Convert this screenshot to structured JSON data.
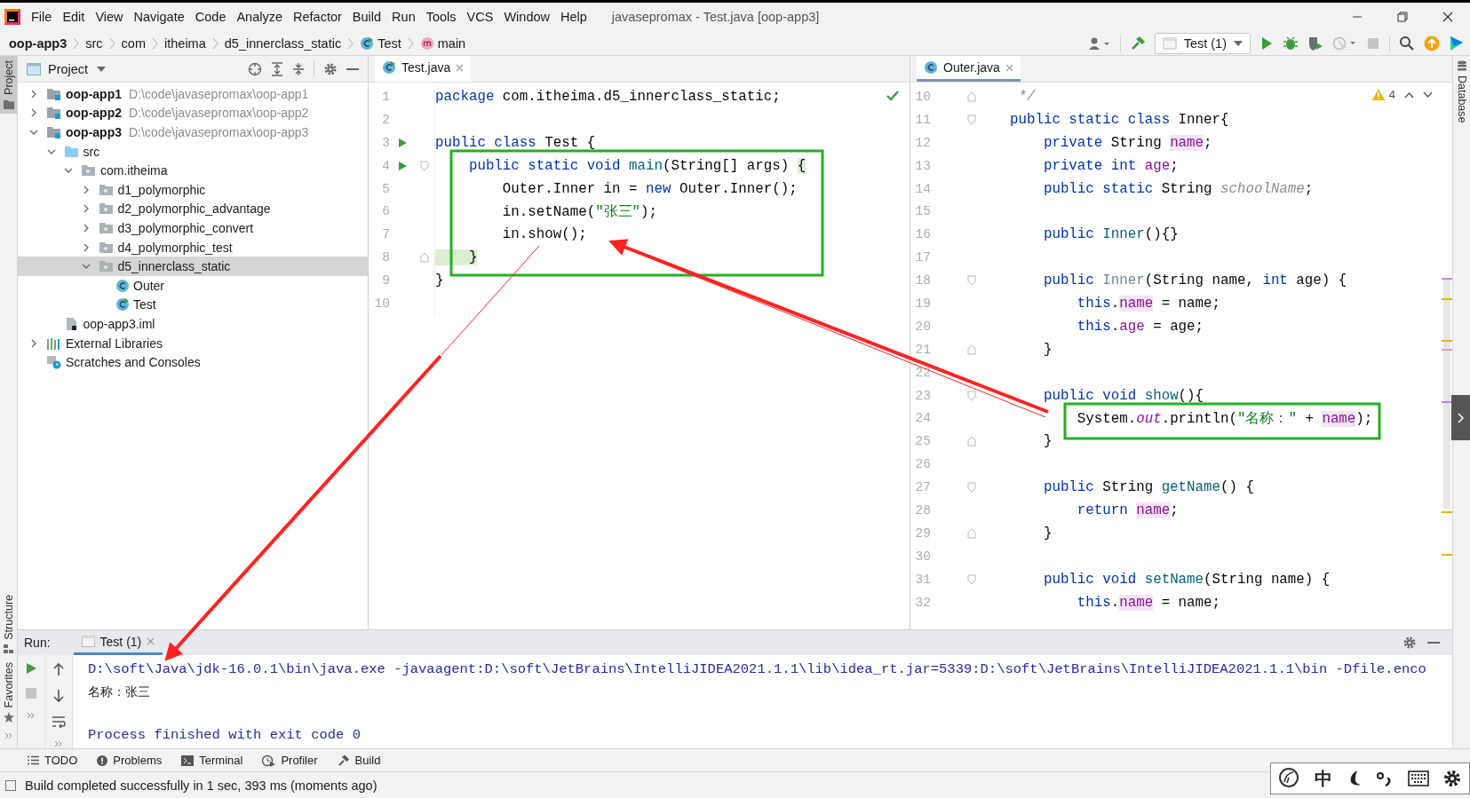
{
  "menu_bar": {
    "menus": [
      "File",
      "Edit",
      "View",
      "Navigate",
      "Code",
      "Analyze",
      "Refactor",
      "Build",
      "Run",
      "Tools",
      "VCS",
      "Window",
      "Help"
    ],
    "title": "javasepromax - Test.java [oop-app3]"
  },
  "breadcrumbs": [
    {
      "label": "oop-app3",
      "kind": "module"
    },
    {
      "label": "src",
      "kind": "folder"
    },
    {
      "label": "com",
      "kind": "folder"
    },
    {
      "label": "itheima",
      "kind": "folder"
    },
    {
      "label": "d5_innerclass_static",
      "kind": "folder"
    },
    {
      "label": "Test",
      "kind": "class"
    },
    {
      "label": "main",
      "kind": "method"
    }
  ],
  "toolbar": {
    "run_config": "Test (1)"
  },
  "left_stripe": [
    {
      "label": "Project",
      "selected": true
    },
    {
      "label": "Structure",
      "selected": false
    },
    {
      "label": "Favorites",
      "selected": false
    }
  ],
  "right_stripe": [
    {
      "label": "Database"
    }
  ],
  "project_panel": {
    "title": "Project",
    "tree": [
      {
        "label": "oop-app1",
        "path": "D:\\code\\javasepromax\\oop-app1",
        "kind": "module",
        "expanded": false,
        "selected": false
      },
      {
        "label": "oop-app2",
        "path": "D:\\code\\javasepromax\\oop-app2",
        "kind": "module",
        "expanded": false,
        "selected": false
      },
      {
        "label": "oop-app3",
        "path": "D:\\code\\javasepromax\\oop-app3",
        "kind": "module",
        "expanded": true,
        "selected": false,
        "children": [
          {
            "label": "src",
            "kind": "source",
            "expanded": true,
            "selected": false,
            "children": [
              {
                "label": "com.itheima",
                "kind": "package",
                "expanded": true,
                "selected": false,
                "children": [
                  {
                    "label": "d1_polymorphic",
                    "kind": "package",
                    "expanded": false,
                    "selected": false
                  },
                  {
                    "label": "d2_polymorphic_advantage",
                    "kind": "package",
                    "expanded": false,
                    "selected": false
                  },
                  {
                    "label": "d3_polymorphic_convert",
                    "kind": "package",
                    "expanded": false,
                    "selected": false
                  },
                  {
                    "label": "d4_polymorphic_test",
                    "kind": "package",
                    "expanded": false,
                    "selected": false
                  },
                  {
                    "label": "d5_innerclass_static",
                    "kind": "package",
                    "expanded": true,
                    "selected": true,
                    "children": [
                      {
                        "label": "Outer",
                        "kind": "class",
                        "selected": false
                      },
                      {
                        "label": "Test",
                        "kind": "main-class",
                        "selected": false
                      }
                    ]
                  }
                ]
              }
            ]
          },
          {
            "label": "oop-app3.iml",
            "kind": "iml",
            "selected": false
          }
        ]
      },
      {
        "label": "External Libraries",
        "kind": "libraries",
        "expanded": false,
        "selected": false
      },
      {
        "label": "Scratches and Consoles",
        "kind": "scratches",
        "selected": false
      }
    ]
  },
  "editors": [
    {
      "tab": {
        "label": "Test.java",
        "selected": false
      },
      "indicator": {
        "kind": "ok"
      },
      "lines": [
        {
          "number": "1",
          "tokens": [
            {
              "kind": "kw",
              "text": "package"
            },
            {
              "kind": "plain",
              "text": " com.itheima.d5_innerclass_static;"
            }
          ]
        },
        {
          "number": "2"
        },
        {
          "number": "3",
          "gutter": {
            "kind": "run"
          },
          "tokens": [
            {
              "kind": "kw",
              "text": "public class"
            },
            {
              "kind": "plain",
              "text": " Test {"
            }
          ]
        },
        {
          "number": "4",
          "gutter": {
            "kind": "run-fold"
          },
          "tokens": [
            {
              "kind": "kw",
              "text": "    public static void "
            },
            {
              "kind": "method",
              "text": "main"
            },
            {
              "kind": "plain",
              "text": "(String[] args) "
            },
            {
              "kind": "brace",
              "text": "{"
            }
          ]
        },
        {
          "number": "5",
          "tokens": [
            {
              "kind": "plain",
              "text": "        Outer.Inner in = "
            },
            {
              "kind": "kw",
              "text": "new"
            },
            {
              "kind": "plain",
              "text": " Outer.Inner();"
            }
          ]
        },
        {
          "number": "6",
          "tokens": [
            {
              "kind": "plain",
              "text": "        in.setName("
            },
            {
              "kind": "str",
              "text": "\"张三\""
            },
            {
              "kind": "plain",
              "text": ");"
            }
          ]
        },
        {
          "number": "7",
          "tokens": [
            {
              "kind": "plain",
              "text": "        in.show();"
            }
          ]
        },
        {
          "number": "8",
          "gutter": {
            "kind": "fold-end"
          },
          "tokens": [
            {
              "kind": "brace",
              "text": "    }"
            }
          ]
        },
        {
          "number": "9",
          "tokens": [
            {
              "kind": "plain",
              "text": "}"
            }
          ]
        },
        {
          "number": "10"
        }
      ]
    },
    {
      "tab": {
        "label": "Outer.java",
        "selected": true
      },
      "indicator": {
        "kind": "warnings",
        "count": "4"
      },
      "lines": [
        {
          "number": "10",
          "gutter": {
            "kind": "fold-end"
          },
          "tokens": [
            {
              "kind": "comment",
              "text": " */"
            }
          ]
        },
        {
          "number": "11",
          "gutter": {
            "kind": "fold"
          },
          "tokens": [
            {
              "kind": "kw",
              "text": "public static class"
            },
            {
              "kind": "plain",
              "text": " Inner{"
            }
          ]
        },
        {
          "number": "12",
          "tokens": [
            {
              "kind": "kw",
              "text": "    private"
            },
            {
              "kind": "plain",
              "text": " String "
            },
            {
              "kind": "field-hl",
              "text": "name"
            },
            {
              "kind": "plain",
              "text": ";"
            }
          ]
        },
        {
          "number": "13",
          "tokens": [
            {
              "kind": "kw",
              "text": "    private int "
            },
            {
              "kind": "field",
              "text": "age"
            },
            {
              "kind": "plain",
              "text": ";"
            }
          ]
        },
        {
          "number": "14",
          "tokens": [
            {
              "kind": "kw",
              "text": "    public static"
            },
            {
              "kind": "plain",
              "text": " String "
            },
            {
              "kind": "unused-static",
              "text": "schoolName"
            },
            {
              "kind": "plain",
              "text": ";"
            }
          ]
        },
        {
          "number": "15"
        },
        {
          "number": "16",
          "tokens": [
            {
              "kind": "kw",
              "text": "    public "
            },
            {
              "kind": "method",
              "text": "Inner"
            },
            {
              "kind": "plain",
              "text": "(){}"
            }
          ]
        },
        {
          "number": "17"
        },
        {
          "number": "18",
          "gutter": {
            "kind": "fold"
          },
          "tokens": [
            {
              "kind": "kw",
              "text": "    public "
            },
            {
              "kind": "unused",
              "text": "Inner"
            },
            {
              "kind": "plain",
              "text": "(String name, "
            },
            {
              "kind": "kw",
              "text": "int"
            },
            {
              "kind": "plain",
              "text": " age) {"
            }
          ]
        },
        {
          "number": "19",
          "tokens": [
            {
              "kind": "kw",
              "text": "        this"
            },
            {
              "kind": "plain",
              "text": "."
            },
            {
              "kind": "field-hl",
              "text": "name"
            },
            {
              "kind": "plain",
              "text": " = name;"
            }
          ]
        },
        {
          "number": "20",
          "tokens": [
            {
              "kind": "kw",
              "text": "        this"
            },
            {
              "kind": "plain",
              "text": "."
            },
            {
              "kind": "field",
              "text": "age"
            },
            {
              "kind": "plain",
              "text": " = age;"
            }
          ]
        },
        {
          "number": "21",
          "gutter": {
            "kind": "fold-end"
          },
          "tokens": [
            {
              "kind": "plain",
              "text": "    }"
            }
          ]
        },
        {
          "number": "22"
        },
        {
          "number": "23",
          "gutter": {
            "kind": "fold"
          },
          "tokens": [
            {
              "kind": "kw",
              "text": "    public void "
            },
            {
              "kind": "method",
              "text": "show"
            },
            {
              "kind": "plain",
              "text": "(){"
            }
          ]
        },
        {
          "number": "24",
          "tokens": [
            {
              "kind": "plain",
              "text": "        System."
            },
            {
              "kind": "static",
              "text": "out"
            },
            {
              "kind": "plain",
              "text": ".println("
            },
            {
              "kind": "str",
              "text": "\"名称：\""
            },
            {
              "kind": "plain",
              "text": " + "
            },
            {
              "kind": "field-hl",
              "text": "name"
            },
            {
              "kind": "plain",
              "text": ");"
            }
          ]
        },
        {
          "number": "25",
          "gutter": {
            "kind": "fold-end"
          },
          "tokens": [
            {
              "kind": "plain",
              "text": "    }"
            }
          ]
        },
        {
          "number": "26"
        },
        {
          "number": "27",
          "gutter": {
            "kind": "fold"
          },
          "tokens": [
            {
              "kind": "kw",
              "text": "    public"
            },
            {
              "kind": "plain",
              "text": " String "
            },
            {
              "kind": "method",
              "text": "getName"
            },
            {
              "kind": "plain",
              "text": "() {"
            }
          ]
        },
        {
          "number": "28",
          "tokens": [
            {
              "kind": "kw",
              "text": "        return "
            },
            {
              "kind": "field-hl",
              "text": "name"
            },
            {
              "kind": "plain",
              "text": ";"
            }
          ]
        },
        {
          "number": "29",
          "gutter": {
            "kind": "fold-end"
          },
          "tokens": [
            {
              "kind": "plain",
              "text": "    }"
            }
          ]
        },
        {
          "number": "30"
        },
        {
          "number": "31",
          "gutter": {
            "kind": "fold"
          },
          "tokens": [
            {
              "kind": "kw",
              "text": "    public void "
            },
            {
              "kind": "method",
              "text": "setName"
            },
            {
              "kind": "plain",
              "text": "(String name) {"
            }
          ]
        },
        {
          "number": "32",
          "tokens": [
            {
              "kind": "kw",
              "text": "        this"
            },
            {
              "kind": "plain",
              "text": "."
            },
            {
              "kind": "field-hl",
              "text": "name"
            },
            {
              "kind": "plain",
              "text": " = name;"
            }
          ]
        }
      ]
    }
  ],
  "run_panel": {
    "label": "Run:",
    "tab": {
      "label": "Test (1)",
      "selected": true
    },
    "console": [
      {
        "kind": "command",
        "text": "D:\\soft\\Java\\jdk-16.0.1\\bin\\java.exe -javaagent:D:\\soft\\JetBrains\\IntelliJIDEA2021.1.1\\lib\\idea_rt.jar=5339:D:\\soft\\JetBrains\\IntelliJIDEA2021.1.1\\bin -Dfile.enco"
      },
      {
        "kind": "output",
        "text": "名称：张三"
      },
      {
        "kind": "exit",
        "text": "Process finished with exit code 0"
      }
    ]
  },
  "tool_windows": [
    {
      "label": "TODO",
      "kind": "todo"
    },
    {
      "label": "Problems",
      "kind": "problems"
    },
    {
      "label": "Terminal",
      "kind": "terminal"
    },
    {
      "label": "Profiler",
      "kind": "profiler"
    },
    {
      "label": "Build",
      "kind": "build"
    }
  ],
  "status_bar": {
    "text": "Build completed successfully in 1 sec, 393 ms (moments ago)"
  },
  "ime_bar": {
    "mode": "中"
  }
}
